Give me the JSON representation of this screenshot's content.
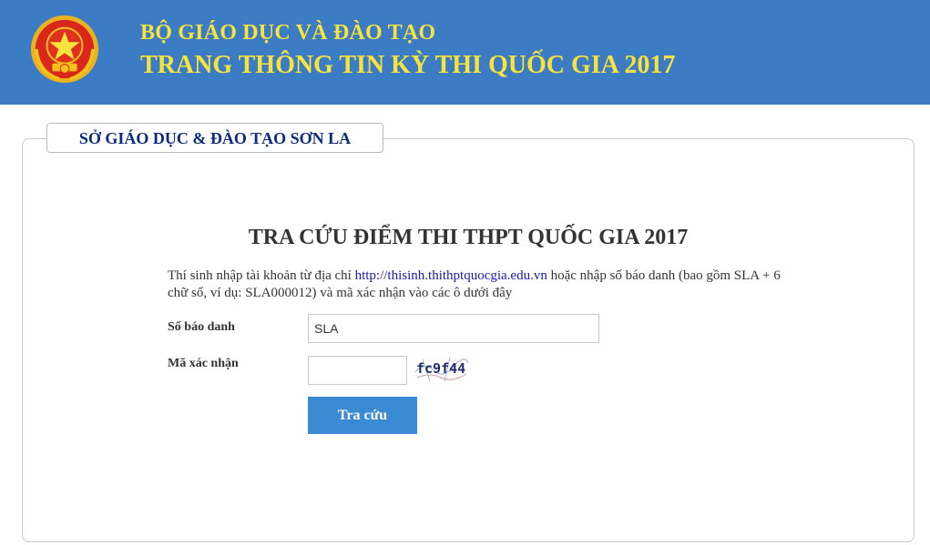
{
  "header": {
    "line1": "BỘ GIÁO DỤC VÀ ĐÀO TẠO",
    "line2": "TRANG THÔNG TIN KỲ THI QUỐC GIA 2017",
    "bg_color": "#3c7cc4",
    "text_color": "#f7e33b",
    "emblem_icon": "vietnam-national-emblem-icon"
  },
  "panel": {
    "tab_label": "SỞ GIÁO DỤC & ĐÀO TẠO SƠN LA",
    "title": "TRA CỨU ĐIỂM THI THPT QUỐC GIA 2017",
    "instructions": {
      "before_link": "Thí sinh nhập tài khoản từ địa chỉ ",
      "link": "http://thisinh.thithptquocgia.edu.vn",
      "after_link": " hoặc nhập số báo danh (bao gồm SLA + 6 chữ số, ví dụ: SLA000012) và mã xác nhận vào các ô dưới đây"
    }
  },
  "form": {
    "sbd_label": "Số báo danh",
    "sbd_value": "SLA",
    "captcha_label": "Mã xác nhận",
    "captcha_value": "",
    "captcha_text": "fc9f44",
    "submit_label": "Tra cứu",
    "button_color": "#3a8bd4"
  }
}
